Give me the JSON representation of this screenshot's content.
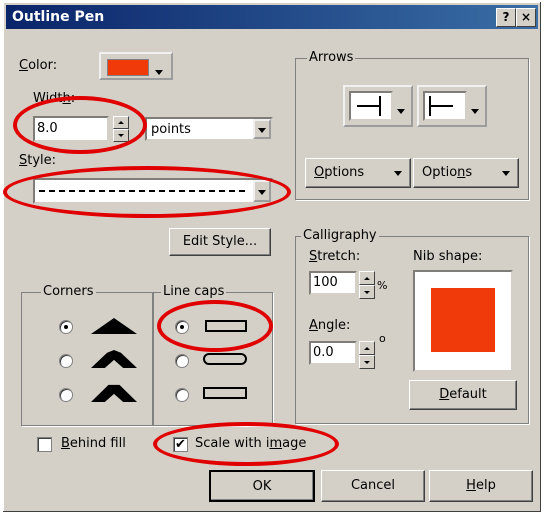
{
  "window": {
    "title": "Outline Pen",
    "help_btn": "?",
    "close_btn": "×"
  },
  "color": {
    "label": "Color:",
    "swatch": "#f03a0a"
  },
  "width": {
    "label": "Width:",
    "value": "8.0",
    "units": "points"
  },
  "style": {
    "label": "Style:"
  },
  "edit_style_label": "Edit Style...",
  "corners": {
    "label": "Corners"
  },
  "line_caps": {
    "label": "Line caps"
  },
  "arrows": {
    "label": "Arrows",
    "options_left": "Options",
    "options_right": "Options"
  },
  "calligraphy": {
    "label": "Calligraphy",
    "stretch_label": "Stretch:",
    "stretch_value": "100",
    "stretch_unit": "%",
    "angle_label": "Angle:",
    "angle_value": "0.0",
    "angle_unit": "o",
    "nib_label": "Nib shape:",
    "nib_color": "#f03a0a",
    "default_label": "Default"
  },
  "behind_fill": {
    "label": "Behind fill",
    "checked": false
  },
  "scale_with_image": {
    "label": "Scale with image",
    "checked": true
  },
  "buttons": {
    "ok": "OK",
    "cancel": "Cancel",
    "help": "Help"
  },
  "annotation_color": "#e00000"
}
